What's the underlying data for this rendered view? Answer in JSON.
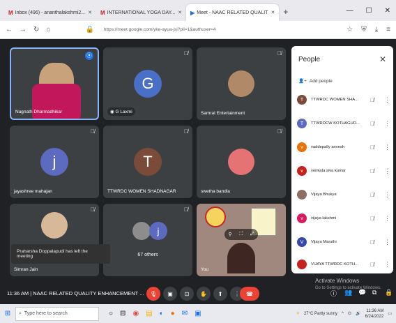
{
  "browser": {
    "tabs": [
      {
        "label": "Inbox (496) - ananthalakshmi2...",
        "fav": "M"
      },
      {
        "label": "INTERNATIONAL YOGA DAY...",
        "fav": "M"
      },
      {
        "label": "Meet - NAAC RELATED QUALIT",
        "fav": "▶",
        "sub": "PLAYING"
      }
    ],
    "url": "https://meet.google.com/yke-ayua-jsi?pli=1&authuser=4"
  },
  "tiles": [
    {
      "name": "Nagnath Dharmadhikar"
    },
    {
      "name": "G Laxmi",
      "initial": "G",
      "color": "#4a6fc6"
    },
    {
      "name": "Samrat Entertainment"
    },
    {
      "name": "jayashree mahajan",
      "initial": "j",
      "color": "#5c6bc0"
    },
    {
      "name": "TTWRDC WOMEN SHADNAGAR",
      "initial": "T",
      "color": "#7b4b3a"
    },
    {
      "name": "swetha bandla"
    },
    {
      "name": "Simran Jain"
    },
    {
      "name": "67 others",
      "initial": "j",
      "color": "#5c6bc0"
    },
    {
      "name": "You"
    }
  ],
  "toast": "Praharsha Doppalapudi has left the meeting",
  "panel": {
    "title": "People",
    "add_label": "Add people",
    "people": [
      {
        "name": "TTWRDC WOMEN SHA...",
        "initial": "T",
        "color": "#7b4b3a"
      },
      {
        "name": "TTWRDCW KOTHAGUD...",
        "initial": "T",
        "color": "#5c6bc0"
      },
      {
        "name": "vaddepally anvesh",
        "initial": "v",
        "color": "#e8710a"
      },
      {
        "name": "venkata siva kumar",
        "initial": "v",
        "color": "#c5221f"
      },
      {
        "name": "Vijaya Bhukya",
        "initial": "",
        "color": "#8d6e63"
      },
      {
        "name": "vijaya lakshmi",
        "initial": "v",
        "color": "#d81b60"
      },
      {
        "name": "Vijaya Maruthi",
        "initial": "V",
        "color": "#3949ab"
      },
      {
        "name": "VIJAYA TTWRDC KOTH...",
        "initial": "",
        "color": "#c5221f"
      }
    ]
  },
  "meeting": {
    "time": "11:36 AM",
    "title": "NAAC RELATED QUALITY ENHANCEMENT ..."
  },
  "activate": {
    "title": "Activate Windows",
    "subtitle": "Go to Settings to activate Windows."
  },
  "taskbar": {
    "search_placeholder": "Type here to search",
    "weather": "27°C Partly sunny",
    "time": "11:36 AM",
    "date": "6/24/2022"
  }
}
